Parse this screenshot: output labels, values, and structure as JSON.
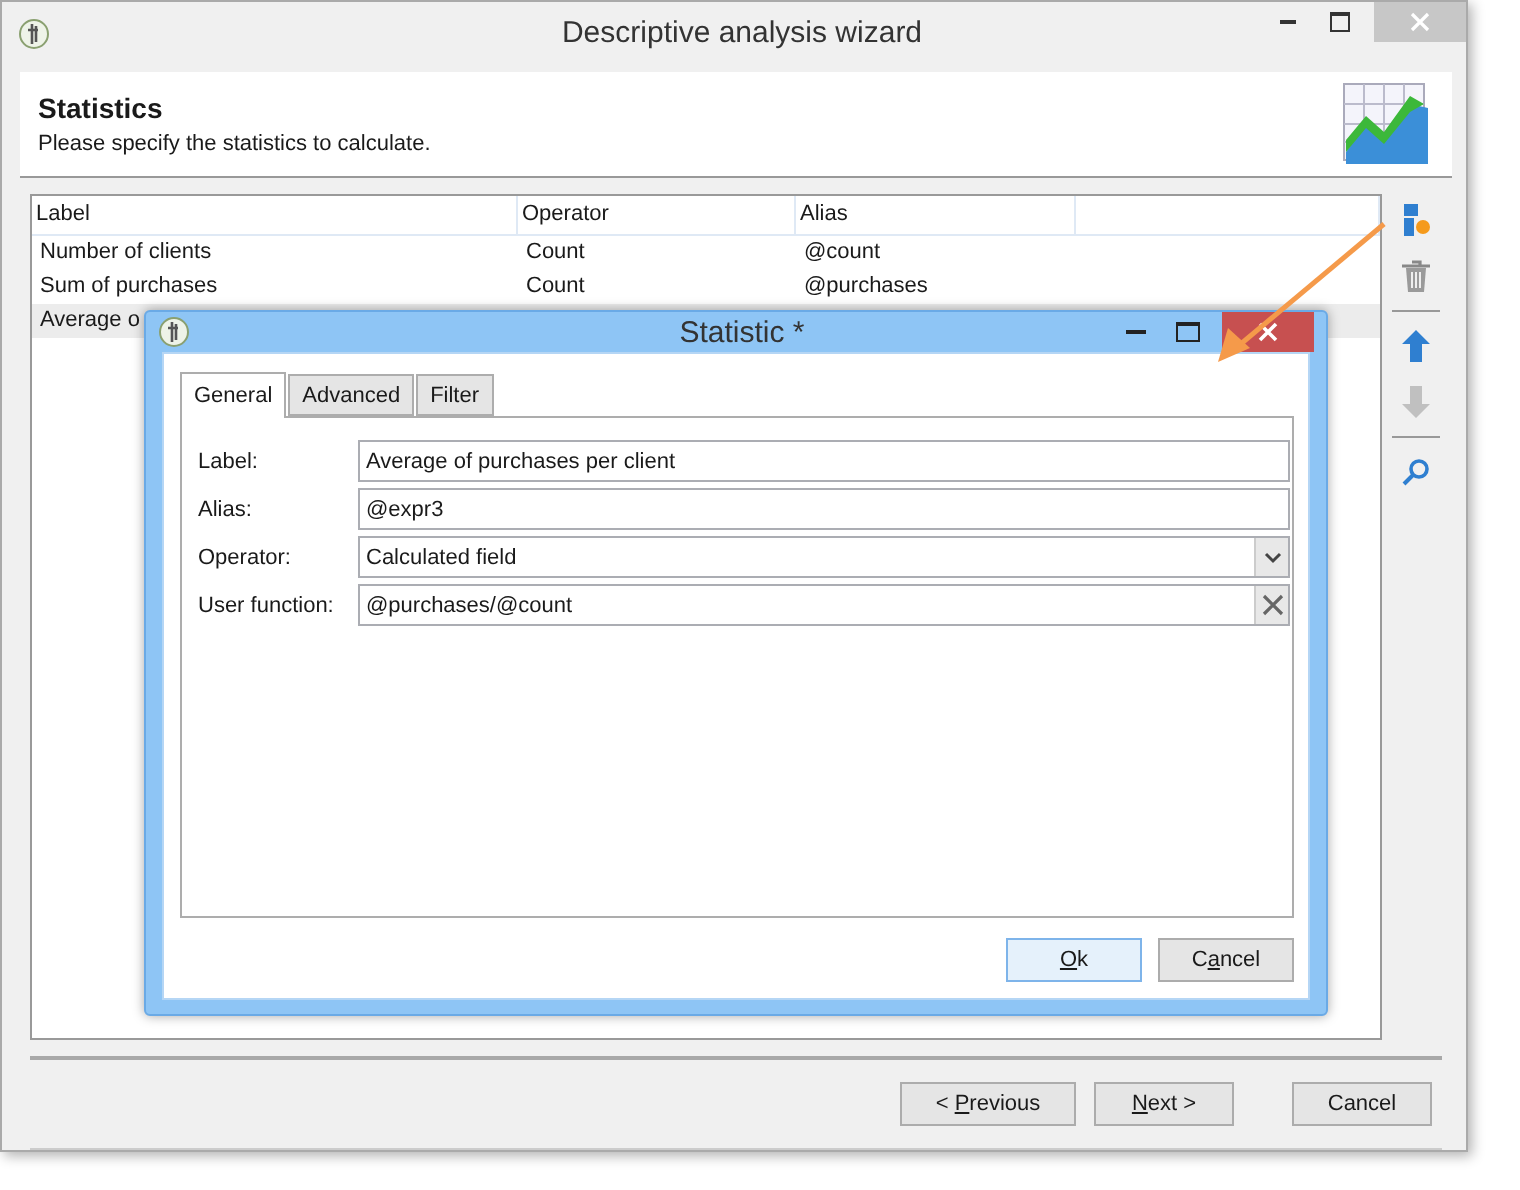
{
  "window": {
    "title": "Descriptive analysis wizard"
  },
  "header": {
    "title": "Statistics",
    "subtitle": "Please specify the statistics to calculate."
  },
  "table": {
    "columns": [
      "Label",
      "Operator",
      "Alias"
    ],
    "rows": [
      {
        "cells": [
          "Number of clients",
          "Count",
          "@count"
        ],
        "selected": false
      },
      {
        "cells": [
          "Sum of purchases",
          "Count",
          "@purchases"
        ],
        "selected": false
      },
      {
        "cells": [
          "Average o"
        ],
        "selected": true
      }
    ]
  },
  "toolbar": [
    {
      "kind": "add",
      "disabled": false
    },
    {
      "kind": "delete",
      "disabled": false
    },
    {
      "kind": "separator"
    },
    {
      "kind": "up",
      "disabled": false
    },
    {
      "kind": "down",
      "disabled": true
    },
    {
      "kind": "separator"
    },
    {
      "kind": "search",
      "disabled": false
    }
  ],
  "footer_buttons": [
    {
      "parts": [
        {
          "text": "< ",
          "mnemonic": false
        },
        {
          "text": "P",
          "mnemonic": true
        },
        {
          "text": "revious",
          "mnemonic": false
        }
      ]
    },
    {
      "parts": [
        {
          "text": "N",
          "mnemonic": true
        },
        {
          "text": "ext >",
          "mnemonic": false
        }
      ]
    },
    {
      "parts": [
        {
          "text": "Cancel",
          "mnemonic": false
        }
      ]
    }
  ],
  "dialog": {
    "title": "Statistic *",
    "tabs": [
      {
        "label": "General",
        "selected": true
      },
      {
        "label": "Advanced",
        "selected": false
      },
      {
        "label": "Filter",
        "selected": false
      }
    ],
    "fields": [
      {
        "label": "Label:",
        "value": "Average of purchases per client",
        "kind": "text"
      },
      {
        "label": "Alias:",
        "value": "@expr3",
        "kind": "text"
      },
      {
        "label": "Operator:",
        "value": "Calculated field",
        "kind": "select"
      },
      {
        "label": "User function:",
        "value": "@purchases/@count",
        "kind": "clearable"
      }
    ],
    "buttons": [
      {
        "parts": [
          {
            "text": "O",
            "mnemonic": true
          },
          {
            "text": "k",
            "mnemonic": false
          }
        ],
        "default": true
      },
      {
        "parts": [
          {
            "text": "C",
            "mnemonic": false
          },
          {
            "text": "a",
            "mnemonic": true
          },
          {
            "text": "ncel",
            "mnemonic": false
          }
        ],
        "default": false
      }
    ]
  }
}
